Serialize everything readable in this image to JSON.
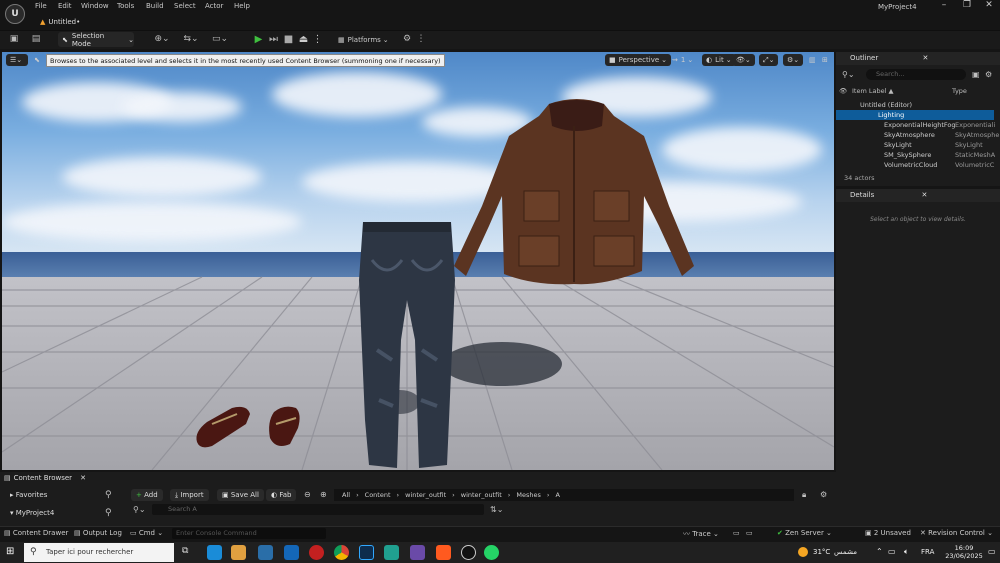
{
  "menu": [
    "File",
    "Edit",
    "Window",
    "Tools",
    "Build",
    "Select",
    "Actor",
    "Help"
  ],
  "document_tab": "Untitled•",
  "project_name": "MyProject4",
  "toolbar": {
    "mode": "Selection Mode",
    "platforms": "Platforms"
  },
  "viewport": {
    "perspective": "Perspective",
    "lit": "Lit",
    "camera_speed": "1",
    "tooltip": "Browses to the associated level and selects it in the most recently used Content Browser (summoning one if necessary)"
  },
  "outliner": {
    "title": "Outliner",
    "search_placeholder": "Search...",
    "col_label": "Item Label ▲",
    "col_type": "Type",
    "rows": [
      {
        "label": "Untitled (Editor)",
        "type": ""
      },
      {
        "label": "Lighting",
        "type": ""
      },
      {
        "label": "ExponentialHeightFog",
        "type": "Exponentiali"
      },
      {
        "label": "SkyAtmosphere",
        "type": "SkyAtmosphe"
      },
      {
        "label": "SkyLight",
        "type": "SkyLight"
      },
      {
        "label": "SM_SkySphere",
        "type": "StaticMeshA"
      },
      {
        "label": "VolumetricCloud",
        "type": "VolumetricC"
      }
    ],
    "actor_count": "34 actors"
  },
  "details": {
    "title": "Details",
    "empty": "Select an object to view details."
  },
  "content_browser": {
    "tab": "Content Browser",
    "favorites": "Favorites",
    "project": "MyProject4",
    "add": "Add",
    "import": "Import",
    "save_all": "Save All",
    "fab": "Fab",
    "path": [
      "All",
      "Content",
      "winter_outfit",
      "winter_outfit",
      "Meshes",
      "A"
    ],
    "search_placeholder": "Search A"
  },
  "statusbar": {
    "content_drawer": "Content Drawer",
    "output_log": "Output Log",
    "cmd": "Cmd",
    "console_placeholder": "Enter Console Command",
    "trace": "Trace",
    "zen": "Zen Server",
    "unsaved": "2 Unsaved",
    "revision": "Revision Control"
  },
  "taskbar": {
    "search": "Taper ici pour rechercher",
    "weather": "31°C",
    "weather_desc": "مشمس",
    "lang": "FRA",
    "time": "16:09",
    "date": "23/06/2025"
  },
  "colors": {
    "accent": "#0e5c9a",
    "play": "#3fbf3f",
    "folder": "#e0a040"
  }
}
